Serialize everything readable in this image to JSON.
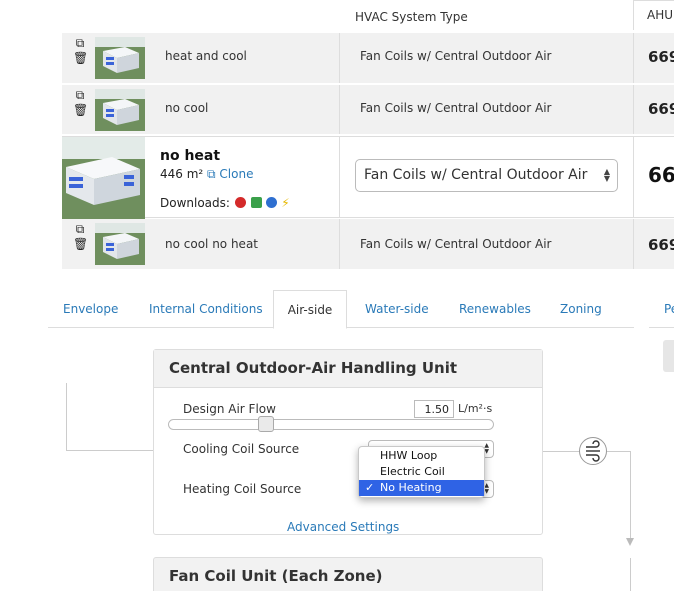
{
  "table": {
    "hvac_header": "HVAC System Type",
    "ahu_tab": "AHU",
    "rows": [
      {
        "name": "heat and cool",
        "hvac": "Fan Coils w/ Central Outdoor Air",
        "ahu": "669"
      },
      {
        "name": "no cool",
        "hvac": "Fan Coils w/ Central Outdoor Air",
        "ahu": "669"
      },
      {
        "name": "no cool no heat",
        "hvac": "Fan Coils w/ Central Outdoor Air",
        "ahu": "669"
      }
    ],
    "expanded": {
      "name": "no heat",
      "area": "446 m²",
      "clone": "Clone",
      "downloads": "Downloads:",
      "hvac_value": "Fan Coils w/ Central Outdoor Air",
      "ahu": "66"
    }
  },
  "tabs": {
    "items": [
      "Envelope",
      "Internal Conditions",
      "Air-side",
      "Water-side",
      "Renewables",
      "Zoning"
    ],
    "active": "Air-side",
    "right_cut": "Pe"
  },
  "panel": {
    "title": "Central Outdoor-Air Handling Unit",
    "design_air_flow_label": "Design Air Flow",
    "design_air_flow_value": "1.50",
    "design_air_flow_unit": "L/m²·s",
    "cooling_label": "Cooling Coil Source",
    "heating_label": "Heating Coil Source",
    "dropdown_options": [
      "HHW Loop",
      "Electric Coil",
      "No Heating"
    ],
    "dropdown_selected": "No Heating",
    "advanced": "Advanced Settings"
  },
  "panel2": {
    "title": "Fan Coil Unit (Each Zone)"
  },
  "icons": {
    "copy": "copy-icon",
    "trash": "trash-icon",
    "clone": "clone-icon",
    "fan": "fan-icon"
  }
}
